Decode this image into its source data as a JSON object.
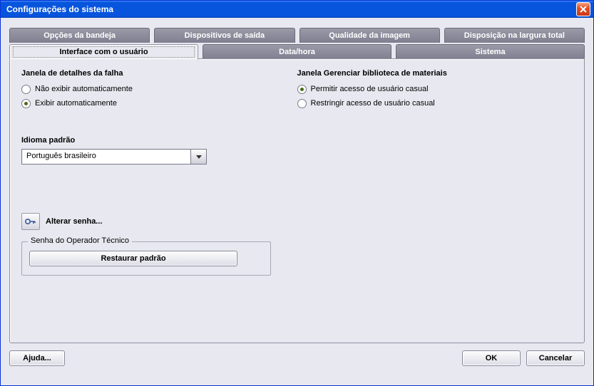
{
  "window": {
    "title": "Configurações do sistema"
  },
  "tabs_row1": [
    {
      "label": "Opções da bandeja"
    },
    {
      "label": "Dispositivos de saída"
    },
    {
      "label": "Qualidade da imagem"
    },
    {
      "label": "Disposição na largura total"
    }
  ],
  "tabs_row2": [
    {
      "label": "Interface com o usuário",
      "active": true
    },
    {
      "label": "Data/hora"
    },
    {
      "label": "Sistema"
    }
  ],
  "fault_window": {
    "title": "Janela de detalhes da falha",
    "options": {
      "no_auto": "Não exibir automaticamente",
      "auto": "Exibir automaticamente"
    },
    "selected": "auto"
  },
  "library_window": {
    "title": "Janela Gerenciar biblioteca de materiais",
    "options": {
      "allow": "Permitir acesso de usuário casual",
      "restrict": "Restringir acesso de usuário casual"
    },
    "selected": "allow"
  },
  "language": {
    "label": "Idioma padrão",
    "value": "Português brasileiro"
  },
  "change_password_label": "Alterar senha...",
  "fieldset": {
    "legend": "Senha do Operador Técnico",
    "restore_label": "Restaurar padrão"
  },
  "buttons": {
    "help": "Ajuda...",
    "ok": "OK",
    "cancel": "Cancelar"
  }
}
